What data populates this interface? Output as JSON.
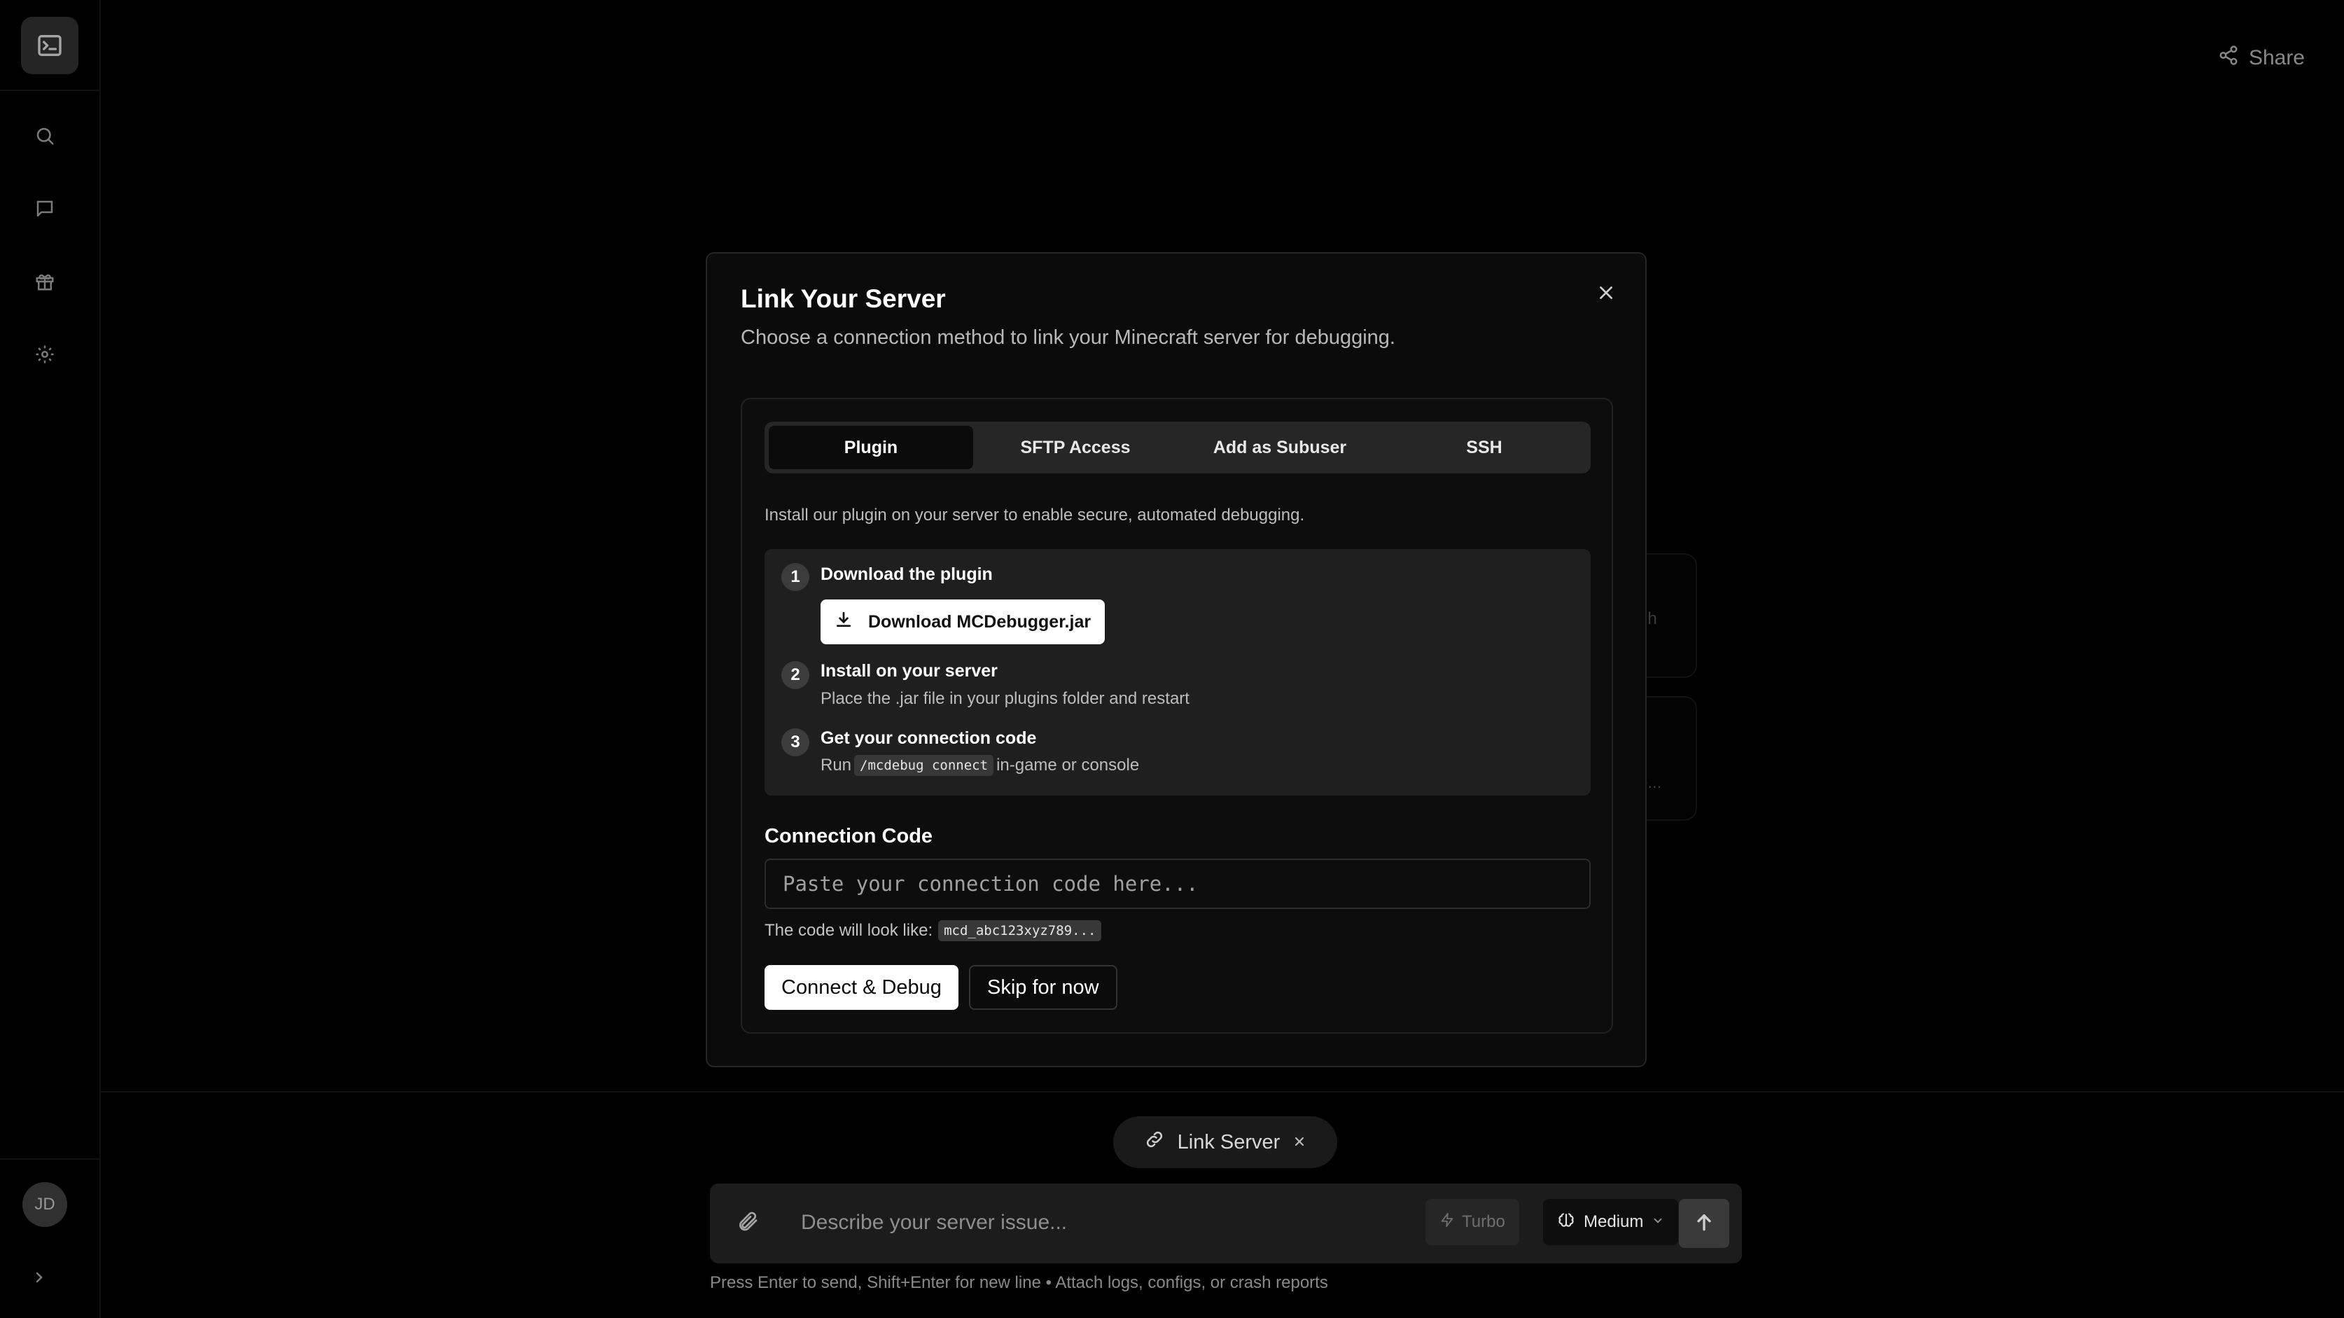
{
  "header": {
    "share_label": "Share"
  },
  "sidebar": {
    "logo_icon": "terminal-icon",
    "items": [
      {
        "icon": "search-icon"
      },
      {
        "icon": "chat-icon"
      },
      {
        "icon": "gift-icon"
      },
      {
        "icon": "gear-icon"
      }
    ],
    "avatar_initials": "JD",
    "expand_icon": "chevron-right-icon"
  },
  "background_cards": [
    {
      "text": "gh"
    },
    {
      "text": "e..."
    }
  ],
  "modal": {
    "title": "Link Your Server",
    "subtitle": "Choose a connection method to link your Minecraft server for debugging.",
    "tabs": [
      {
        "label": "Plugin",
        "active": true
      },
      {
        "label": "SFTP Access",
        "active": false
      },
      {
        "label": "Add as Subuser",
        "active": false
      },
      {
        "label": "SSH",
        "active": false
      }
    ],
    "intro": "Install our plugin on your server to enable secure, automated debugging.",
    "steps": [
      {
        "number": "1",
        "title": "Download the plugin",
        "button_label": "Download MCDebugger.jar"
      },
      {
        "number": "2",
        "title": "Install on your server",
        "description": "Place the .jar file in your plugins folder and restart"
      },
      {
        "number": "3",
        "title": "Get your connection code",
        "desc_prefix": "Run",
        "code": "/mcdebug connect",
        "desc_suffix": "in-game or console"
      }
    ],
    "connection_code": {
      "label": "Connection Code",
      "placeholder": "Paste your connection code here...",
      "value": "",
      "hint_prefix": "The code will look like:",
      "hint_example": "mcd_abc123xyz789..."
    },
    "primary_button": "Connect & Debug",
    "secondary_button": "Skip for now"
  },
  "bottom": {
    "chip_label": "Link Server",
    "composer_placeholder": "Describe your server issue...",
    "turbo_label": "Turbo",
    "medium_label": "Medium",
    "hint": "Press Enter to send, Shift+Enter for new line • Attach logs, configs, or crash reports"
  },
  "colors": {
    "background": "#000000",
    "modal": "#0b0b0b",
    "accent_button": "#ffffff"
  }
}
